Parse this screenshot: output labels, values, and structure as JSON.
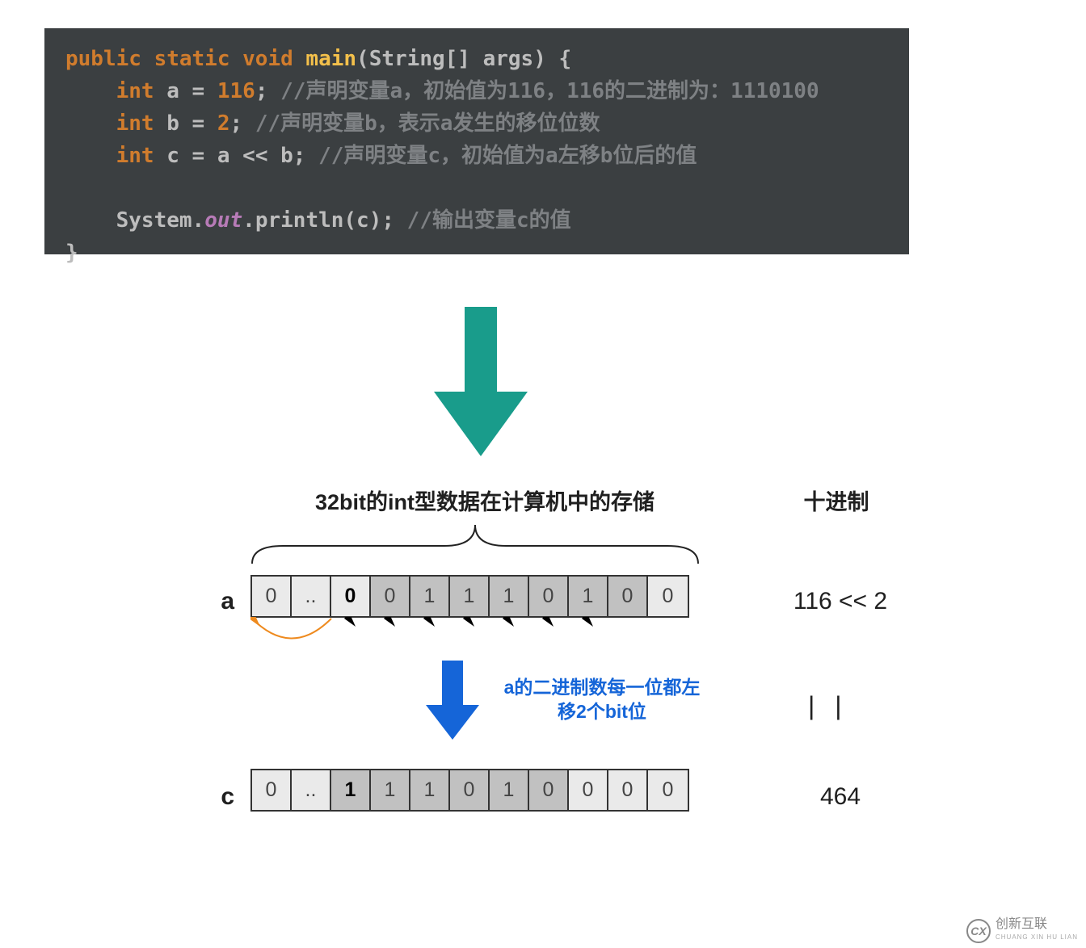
{
  "code": {
    "line1": {
      "k1": "public static void ",
      "fn": "main",
      "tail": "(String[] args) {"
    },
    "line2": {
      "indent": "    ",
      "kw": "int ",
      "body": "a = ",
      "kw2": "116",
      "sc": "; ",
      "cm": "//声明变量a，初始值为116，116的二进制为：1110100"
    },
    "line3": {
      "indent": "    ",
      "kw": "int ",
      "body": "b = ",
      "kw2": "2",
      "sc": "; ",
      "cm": "//声明变量b，表示a发生的移位位数"
    },
    "line4": {
      "indent": "    ",
      "kw": "int ",
      "body": "c = a << b; ",
      "cm": "//声明变量c，初始值为a左移b位后的值"
    },
    "line5": {
      "indent": "    ",
      "body": "System.",
      "it": "out",
      "tail": ".println(c); ",
      "cm": "//输出变量c的值"
    },
    "line6": "}"
  },
  "diagram": {
    "storage_title": "32bit的int型数据在计算机中的存储",
    "decimal_title": "十进制",
    "row_a": {
      "label": "a",
      "bits": [
        "0",
        "..",
        "0",
        "0",
        "1",
        "1",
        "1",
        "0",
        "1",
        "0",
        "0"
      ],
      "shade": [
        "l",
        "l",
        "l",
        "d",
        "d",
        "d",
        "d",
        "d",
        "d",
        "d",
        "l"
      ],
      "bold_idx": 2,
      "dec": "116 << 2"
    },
    "blue_text_l1": "a的二进制数每一位都左",
    "blue_text_l2": "移2个bit位",
    "pipes": "| |",
    "row_c": {
      "label": "c",
      "bits": [
        "0",
        "..",
        "1",
        "1",
        "1",
        "0",
        "1",
        "0",
        "0",
        "0",
        "0"
      ],
      "shade": [
        "l",
        "l",
        "d",
        "d",
        "d",
        "d",
        "d",
        "d",
        "l",
        "l",
        "l"
      ],
      "bold_idx": 2,
      "dec": "464"
    }
  },
  "watermark": {
    "main": "创新互联",
    "sub": "CHUANG XIN HU LIAN",
    "logo": "CX"
  }
}
